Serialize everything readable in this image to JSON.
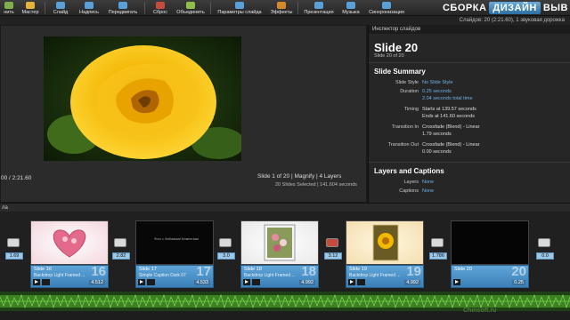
{
  "toolbar": {
    "items": [
      {
        "label": "нить",
        "icon": "cut-icon",
        "color": "#7fb04a"
      },
      {
        "label": "Мастер",
        "icon": "wizard-icon",
        "color": "#e6b23c"
      },
      {
        "label": "Слайд",
        "icon": "slide-icon",
        "color": "#5aa0d8"
      },
      {
        "label": "Надпись",
        "icon": "caption-icon",
        "color": "#5aa0d8"
      },
      {
        "label": "Передвигать",
        "icon": "move-icon",
        "color": "#5aa0d8"
      },
      {
        "label": "Сброс",
        "icon": "reset-icon",
        "color": "#c54b3c"
      },
      {
        "label": "Объединить",
        "icon": "merge-icon",
        "color": "#8fc04a"
      },
      {
        "label": "Параметры слайда",
        "icon": "slide-options-icon",
        "color": "#5aa0d8"
      },
      {
        "label": "Эффекты",
        "icon": "effects-icon",
        "color": "#d58a2a"
      },
      {
        "label": "Презентация",
        "icon": "presentation-icon",
        "color": "#5aa0d8"
      },
      {
        "label": "Музыка",
        "icon": "music-icon",
        "color": "#5aa0d8"
      },
      {
        "label": "Синхронизация",
        "icon": "sync-icon",
        "color": "#5aa0d8"
      }
    ],
    "brand": [
      "СБОРКА",
      "ДИЗАЙН",
      "ВЫВ"
    ]
  },
  "status": {
    "text": "Слайдов: 20 (2:21.60), 1 звуковая дорожка"
  },
  "preview": {
    "time": "00 / 2:21.60",
    "slide_info": "Slide 1 of 20  |  Magnify  |  4 Layers",
    "selection_info": "20 Slides Selected  |  141.604 seconds"
  },
  "inspector": {
    "header": "Инспектор слайдов",
    "title": "Slide 20",
    "subtitle": "Slide 20 of 20",
    "summary_title": "Slide Summary",
    "rows": [
      {
        "label": "Slide Style",
        "values": [
          "No Slide Style"
        ],
        "blue": true
      },
      {
        "label": "Duration",
        "values": [
          "0.25 seconds",
          "2.04 seconds total time"
        ],
        "blue": true
      },
      {
        "label": "Timing",
        "values": [
          "Starts at 139.57 seconds",
          "Ends at 141.60 seconds"
        ],
        "blue": false
      },
      {
        "label": "Transition In",
        "values": [
          "Crossfade (Blend) - Linear",
          "1.79 seconds"
        ],
        "blue": false
      },
      {
        "label": "Transition Out",
        "values": [
          "Crossfade (Blend) - Linear",
          "0.00 seconds"
        ],
        "blue": false
      }
    ],
    "layers_title": "Layers and Captions",
    "layer_rows": [
      {
        "label": "Layers",
        "value": "None"
      },
      {
        "label": "Captions",
        "value": "None"
      }
    ]
  },
  "timeline": {
    "bar_label": "ла",
    "transitions": [
      "1.69",
      "2.82",
      "3.0",
      "3.12",
      "1.786",
      "0.0"
    ],
    "slides": [
      {
        "name": "Slide 16",
        "style": "Backdrop Light Framed ...",
        "num": "16",
        "time": "4.512"
      },
      {
        "name": "Slide 17",
        "style": "Simple Caption Dark 07",
        "num": "17",
        "time": "4.533"
      },
      {
        "name": "Slide 18",
        "style": "Backdrop Light Framed ...",
        "num": "18",
        "time": "4.992"
      },
      {
        "name": "Slide 19",
        "style": "Backdrop Light Framed ...",
        "num": "19",
        "time": "4.992"
      },
      {
        "name": "Slide 20",
        "style": "",
        "num": "20",
        "time": "0.25"
      }
    ],
    "thumb_caption": "Фото с Любимыми Моментами"
  },
  "watermark": "Сhinsoft.ru"
}
